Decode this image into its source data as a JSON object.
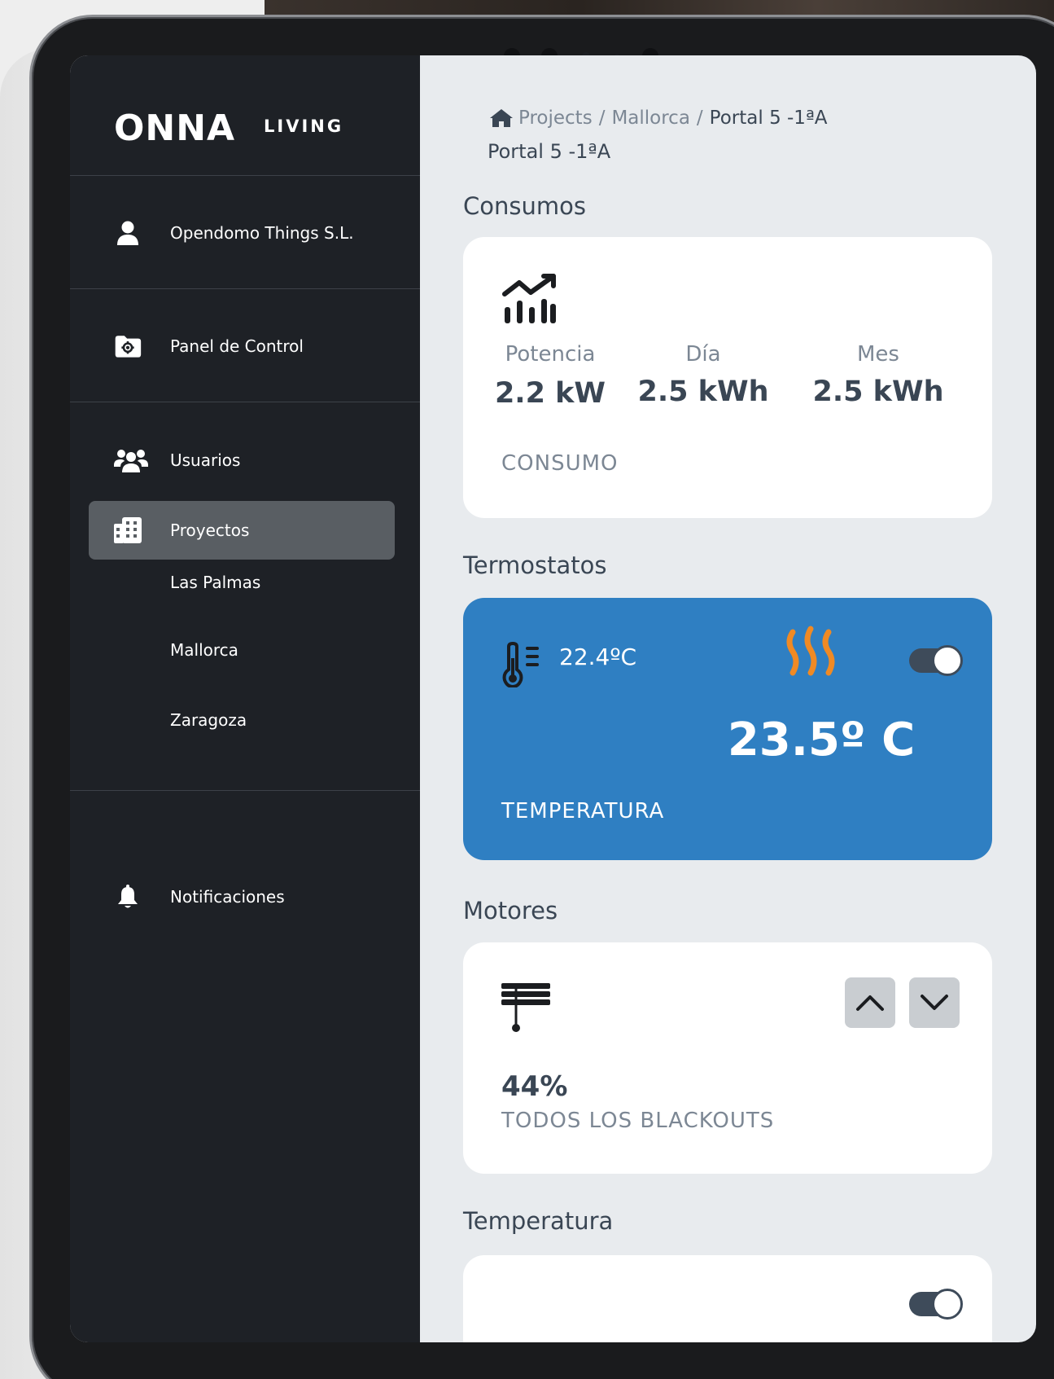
{
  "brand": {
    "logo": "ONNA",
    "tagline": "LIVING"
  },
  "sidebar": {
    "account_name": "Opendomo Things S.L.",
    "panel_label": "Panel de Control",
    "users_label": "Usuarios",
    "projects_label": "Proyectos",
    "project_children": [
      "Las Palmas",
      "Mallorca",
      "Zaragoza"
    ],
    "notifications_label": "Notificaciones"
  },
  "breadcrumb": {
    "items": [
      "Projects",
      "Mallorca"
    ],
    "current": "Portal 5 -1ªA",
    "separator": "/"
  },
  "page": {
    "subtitle": "Portal 5 -1ªA"
  },
  "consumos": {
    "title": "Consumos",
    "potencia_label": "Potencia",
    "potencia_value": "2.2 kW",
    "dia_label": "Día",
    "dia_value": "2.5 kWh",
    "mes_label": "Mes",
    "mes_value": "2.5 kWh",
    "caption": "CONSUMO"
  },
  "termostatos": {
    "title": "Termostatos",
    "current_temp": "22.4ºC",
    "setpoint": "23.5º C",
    "caption": "TEMPERATURA",
    "toggle_on": true,
    "card_color": "#2f7fc2",
    "heat_color": "#f08a24"
  },
  "motores": {
    "title": "Motores",
    "percent": "44%",
    "caption": "TODOS LOS BLACKOUTS"
  },
  "temperatura": {
    "title": "Temperatura",
    "toggle_on": true
  }
}
